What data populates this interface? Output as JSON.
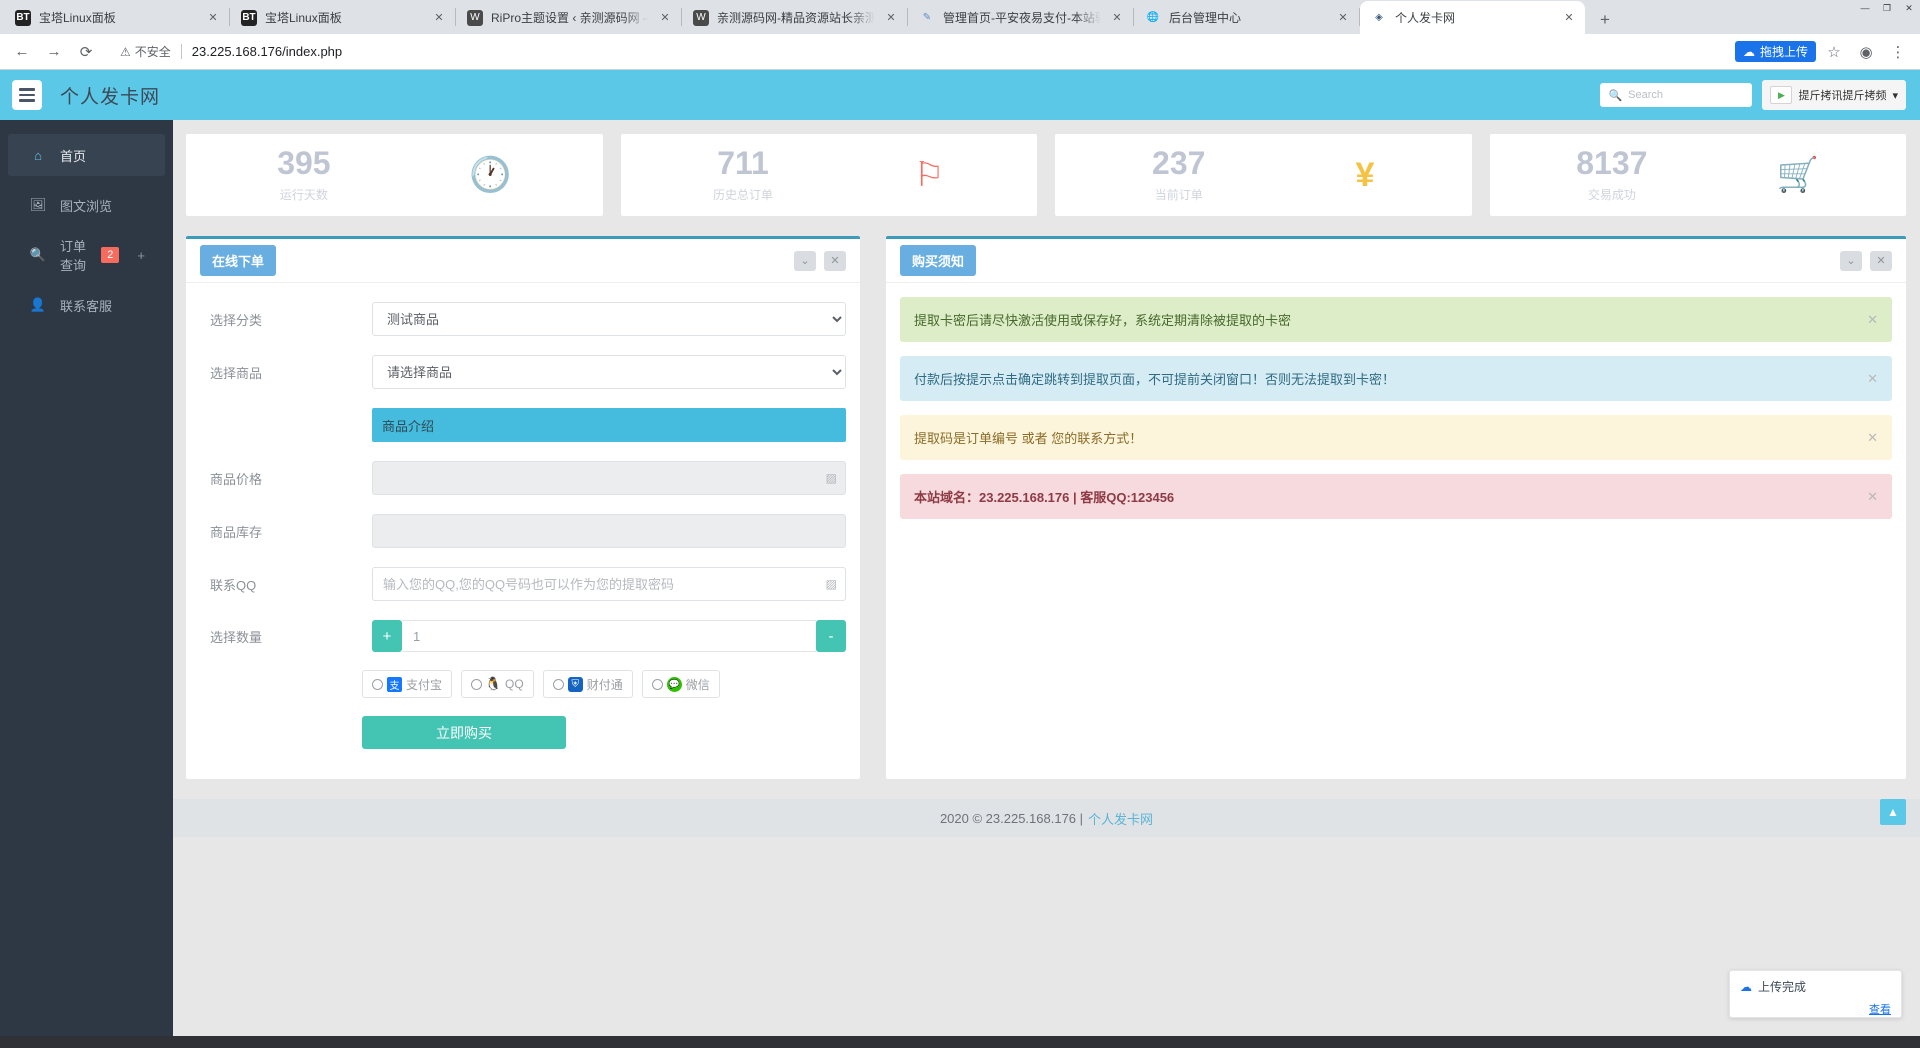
{
  "browser": {
    "tabs": [
      {
        "title": "宝塔Linux面板",
        "favicon": "bt-panel-icon",
        "active": false
      },
      {
        "title": "宝塔Linux面板",
        "favicon": "bt-panel-icon",
        "active": false
      },
      {
        "title": "RiPro主题设置 ‹ 亲测源码网 — W",
        "favicon": "wordpress-icon",
        "active": false
      },
      {
        "title": "亲测源码网-精品资源站长亲测",
        "favicon": "wordpress-icon",
        "active": false
      },
      {
        "title": "管理首页-平安夜易支付-本站骄傲",
        "favicon": "feather-icon",
        "active": false
      },
      {
        "title": "后台管理中心",
        "favicon": "globe-icon",
        "active": false
      },
      {
        "title": "个人发卡网",
        "favicon": "cards-icon",
        "active": true
      }
    ],
    "new_tab_label": "+",
    "close_label": "✕",
    "window_controls": [
      "—",
      "❐",
      "✕"
    ],
    "nav": {
      "back": "←",
      "forward": "→",
      "reload": "⟳"
    },
    "omnibox": {
      "warning_icon": "not-secure-icon",
      "warning_text": "不安全",
      "url": "23.225.168.176/index.php"
    },
    "upload_pill_label": "拖拽上传",
    "star_icon": "☆",
    "profile_icon": "account-icon",
    "menu_icon": "⋮"
  },
  "site": {
    "header": {
      "brand": "个人发卡网",
      "search_placeholder": "Search",
      "plugin_label": "提斤拷讯提斤拷频",
      "plugin_caret": "▾"
    },
    "sidebar": [
      {
        "label": "首页",
        "icon": "home-icon",
        "active": true,
        "badge": null,
        "plus": false
      },
      {
        "label": "图文浏览",
        "icon": "image-icon",
        "active": false,
        "badge": null,
        "plus": false
      },
      {
        "label": "订单查询",
        "icon": "search-icon",
        "active": false,
        "badge": "2",
        "plus": true
      },
      {
        "label": "联系客服",
        "icon": "user-icon",
        "active": false,
        "badge": null,
        "plus": false
      }
    ],
    "stats": [
      {
        "value": "395",
        "label": "运行天数",
        "icon": "clock-icon",
        "color": "#4aa8d8"
      },
      {
        "value": "711",
        "label": "历史总订单",
        "icon": "flag-icon",
        "color": "#f76b5e"
      },
      {
        "value": "237",
        "label": "当前订单",
        "icon": "yen-icon",
        "color": "#f5c243"
      },
      {
        "value": "8137",
        "label": "交易成功",
        "icon": "cart-icon",
        "color": "#8e44ad"
      }
    ],
    "order_panel": {
      "tag": "在线下单",
      "collapse_icon": "⌄",
      "close_icon": "✕",
      "fields": {
        "category_label": "选择分类",
        "category_value": "测试商品",
        "product_label": "选择商品",
        "product_value": "请选择商品",
        "intro_label": "商品介绍",
        "price_label": "商品价格",
        "price_value": "",
        "stock_label": "商品库存",
        "stock_value": "",
        "qq_label": "联系QQ",
        "qq_placeholder": "输入您的QQ,您的QQ号码也可以作为您的提取密码",
        "qty_label": "选择数量",
        "qty_value": "1",
        "qty_plus": "+",
        "qty_minus": "-"
      },
      "payments": [
        {
          "label": "支付宝",
          "logo": "alipay-icon"
        },
        {
          "label": "QQ",
          "logo": "qq-penguin-icon"
        },
        {
          "label": "财付通",
          "logo": "tenpay-icon"
        },
        {
          "label": "微信",
          "logo": "wechat-icon"
        }
      ],
      "buy_button": "立即购买"
    },
    "notice_panel": {
      "tag": "购买须知",
      "collapse_icon": "⌄",
      "close_icon": "✕",
      "notices": [
        {
          "text": "提取卡密后请尽快激活使用或保存好，系统定期清除被提取的卡密",
          "style": "green",
          "close": "✕"
        },
        {
          "text": "付款后按提示点击确定跳转到提取页面，不可提前关闭窗口！否则无法提取到卡密！",
          "style": "blue",
          "close": "✕"
        },
        {
          "text": "提取码是订单编号 或者 您的联系方式！",
          "style": "yellow",
          "close": "✕"
        },
        {
          "text": "本站域名：23.225.168.176 | 客服QQ:123456",
          "style": "red",
          "close": "✕"
        }
      ]
    },
    "footer": {
      "copyright": "2020 © 23.225.168.176 |",
      "link": "个人发卡网",
      "to_top_icon": "▲"
    },
    "toast": {
      "title": "上传完成",
      "link": "查看",
      "icon": "upload-icon"
    }
  }
}
